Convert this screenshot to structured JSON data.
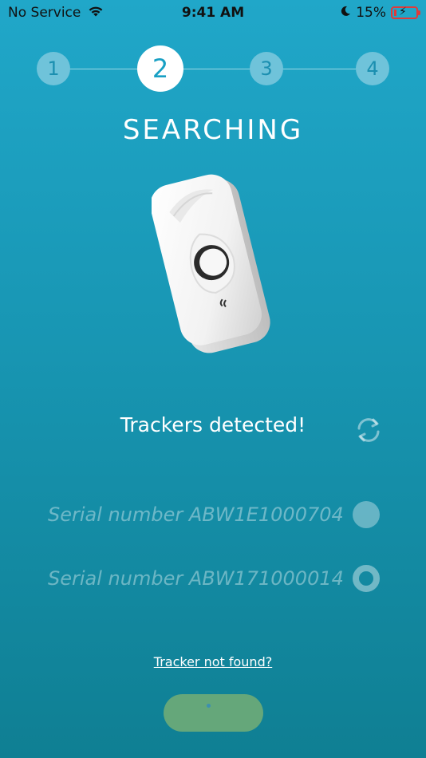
{
  "status_bar": {
    "carrier": "No Service",
    "time": "9:41 AM",
    "battery": "15%",
    "icons": [
      "wifi-icon",
      "moon-icon",
      "battery-icon"
    ]
  },
  "stepper": {
    "steps": [
      "1",
      "2",
      "3",
      "4"
    ],
    "active_step": 2
  },
  "title": "SEARCHING",
  "detected_text": "Trackers detected!",
  "trackers": [
    {
      "serial": "Serial number ABW1E1000704",
      "state": "filled"
    },
    {
      "serial": "Serial number ABW171000014",
      "state": "ring"
    }
  ],
  "link_text": "Tracker not found?",
  "colors": {
    "background_top": "#20a7c9",
    "background_bottom": "#0f7f93",
    "step_inactive": "#6fc3da",
    "button": "#65a77a",
    "battery_low": "#e03a3a"
  }
}
